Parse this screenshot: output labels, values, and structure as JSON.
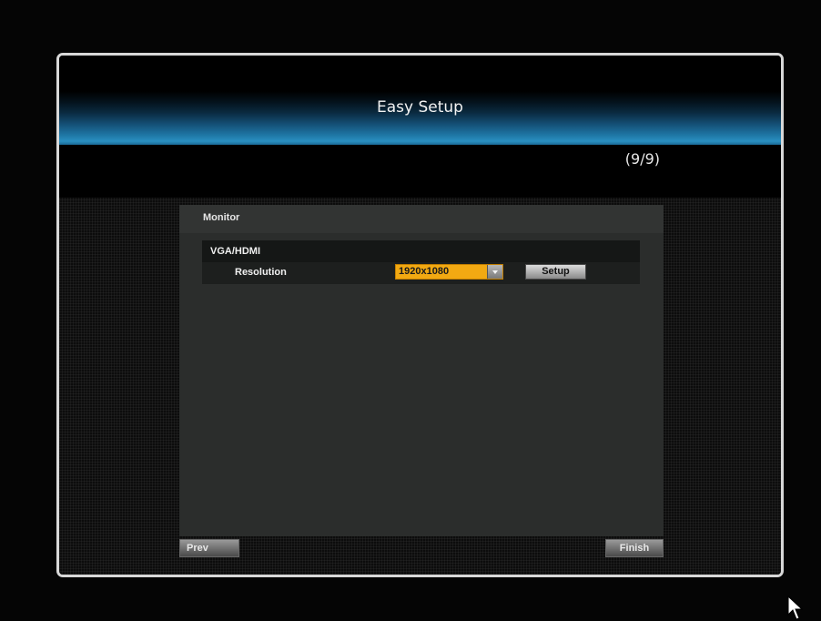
{
  "dialog": {
    "title": "Easy Setup",
    "step": "(9/9)"
  },
  "panel": {
    "title": "Monitor",
    "section": {
      "title": "VGA/HDMI",
      "row": {
        "label": "Resolution",
        "select_value": "1920x1080",
        "setup_label": "Setup"
      }
    }
  },
  "footer": {
    "prev_label": "Prev",
    "finish_label": "Finish"
  },
  "colors": {
    "accent_select": "#f2a912",
    "title_gradient": "#2a8fc0"
  },
  "icons": {
    "dropdown": "chevron-down-icon",
    "cursor": "mouse-pointer-icon"
  }
}
